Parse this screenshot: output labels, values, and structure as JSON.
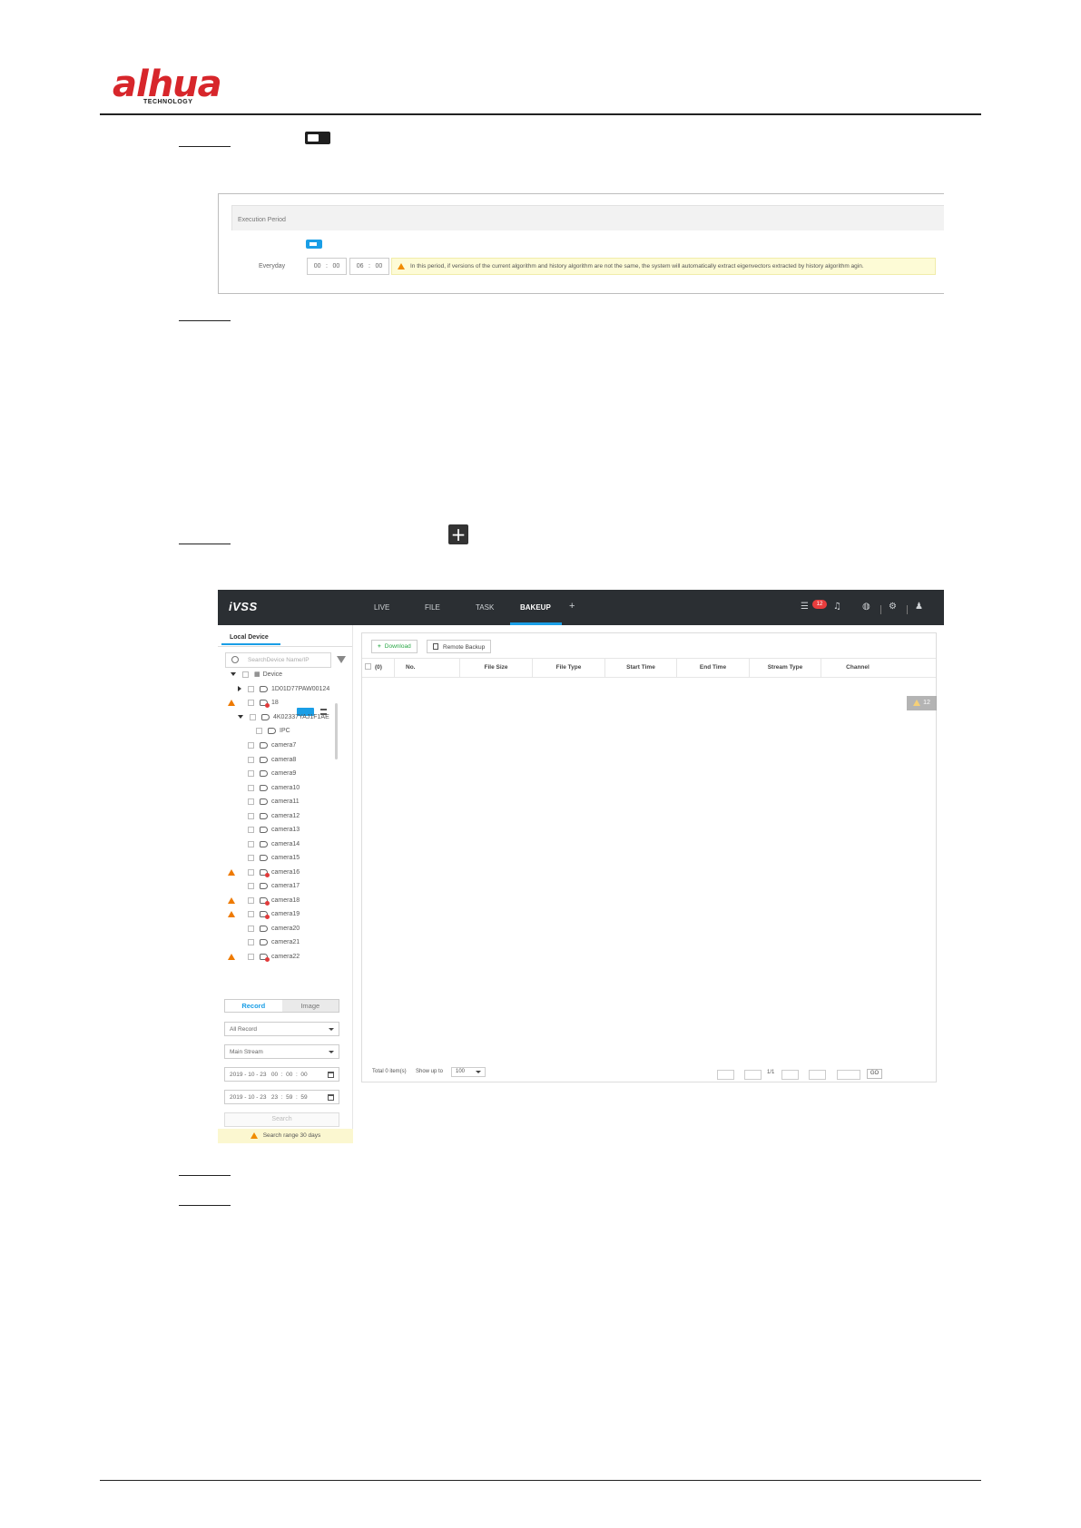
{
  "document": {
    "logo": "alhua",
    "logo_sub": "TECHNOLOGY",
    "logo_color": "#d7262b"
  },
  "execution_period": {
    "title": "Execution Period",
    "day_label": "Everyday",
    "start": [
      "00",
      "00"
    ],
    "end": [
      "06",
      "00"
    ],
    "warning": "In this period, if versions of the current algorithm and history algorithm are not the same, the system will automatically extract eigenvectors extracted by history algorithm agin."
  },
  "ivss": {
    "brand": "iVSS",
    "nav": [
      "LIVE",
      "FILE",
      "TASK",
      "BAKEUP",
      "+"
    ],
    "active_tab": "BAKEUP",
    "notification_count": "12",
    "accent": "#1a9ee6",
    "left": {
      "tab": "Local Device",
      "search_placeholder": "SearchDevice Name/IP",
      "tree": [
        {
          "label": "Device",
          "kind": "root"
        },
        {
          "label": "1D01D77PAW00124",
          "kind": "device"
        },
        {
          "label": "18",
          "kind": "device-off",
          "warn": true
        },
        {
          "label": "4K02337YAJ1F1AE",
          "kind": "device-open"
        },
        {
          "label": "IPC",
          "kind": "cam"
        },
        {
          "label": "camera7",
          "kind": "cam"
        },
        {
          "label": "camera8",
          "kind": "cam"
        },
        {
          "label": "camera9",
          "kind": "cam"
        },
        {
          "label": "camera10",
          "kind": "cam"
        },
        {
          "label": "camera11",
          "kind": "cam"
        },
        {
          "label": "camera12",
          "kind": "cam"
        },
        {
          "label": "camera13",
          "kind": "cam"
        },
        {
          "label": "camera14",
          "kind": "cam"
        },
        {
          "label": "camera15",
          "kind": "cam"
        },
        {
          "label": "camera16",
          "kind": "cam-off",
          "warn": true
        },
        {
          "label": "camera17",
          "kind": "cam"
        },
        {
          "label": "camera18",
          "kind": "cam-off",
          "warn": true
        },
        {
          "label": "camera19",
          "kind": "cam-off",
          "warn": true
        },
        {
          "label": "camera20",
          "kind": "cam"
        },
        {
          "label": "camera21",
          "kind": "cam"
        },
        {
          "label": "camera22",
          "kind": "cam-off",
          "warn": true
        }
      ],
      "seg_record": "Record",
      "seg_image": "Image",
      "record_type": "All Record",
      "stream": "Main Stream",
      "start_time": "2019 - 10 - 23   00  :  00  :  00",
      "end_time": "2019 - 10 - 23   23  :  59  :  59",
      "search_button": "Search",
      "range_note": "Search range 30 days"
    },
    "main": {
      "download": "Download",
      "remote_backup": "Remote Backup",
      "columns": [
        "(0)",
        "No.",
        "File Size",
        "File Type",
        "Start Time",
        "End Time",
        "Stream Type",
        "Channel"
      ],
      "total": "Total 0 item(s)",
      "show_up_to": "Show up to",
      "page_size": "100",
      "page": "1/1",
      "go": "GO",
      "alarm_chip": "12"
    }
  }
}
